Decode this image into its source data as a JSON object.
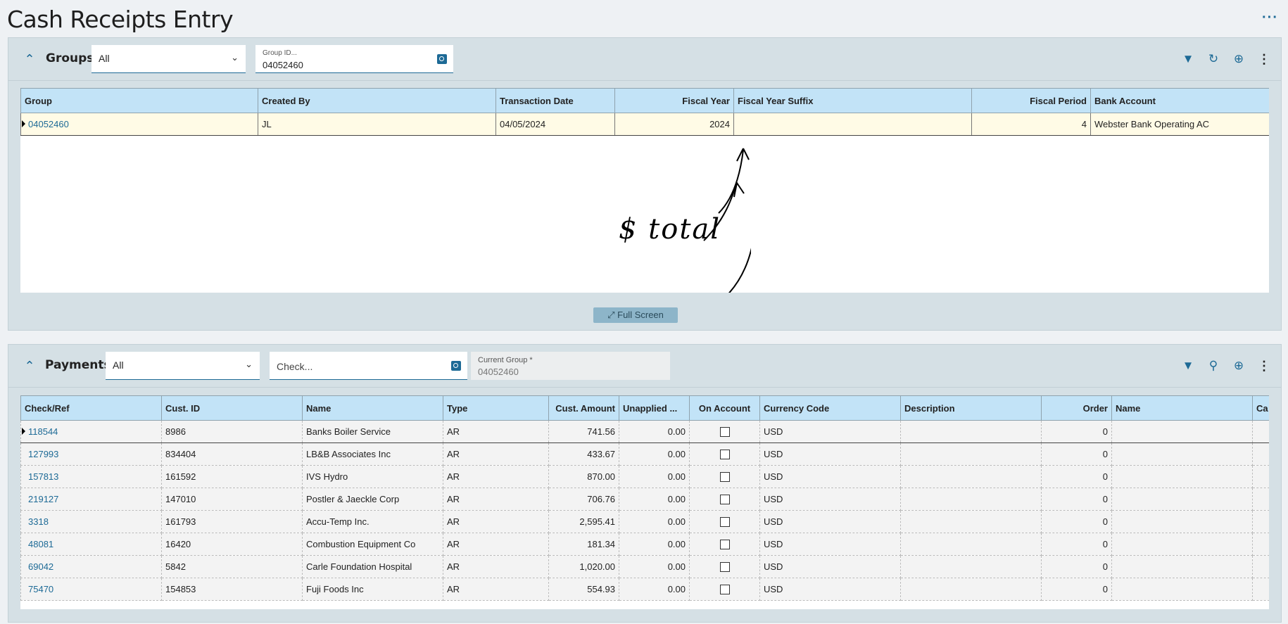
{
  "page": {
    "title": "Cash Receipts Entry",
    "more_label": "···"
  },
  "groups": {
    "title": "Groups",
    "filter_value": "All",
    "search": {
      "label": "Group ID...",
      "value": "04052460"
    },
    "columns": [
      "Group",
      "Created By",
      "Transaction Date",
      "Fiscal Year",
      "Fiscal Year Suffix",
      "Fiscal Period",
      "Bank Account"
    ],
    "rows": [
      {
        "group": "04052460",
        "created_by": "JL",
        "date": "04/05/2024",
        "year": "2024",
        "suffix": "",
        "period": "4",
        "bank": "Webster Bank Operating AC"
      }
    ],
    "full_screen_label": "Full Screen",
    "annotation_text": "$ total"
  },
  "payments": {
    "title": "Payments",
    "filter_value": "All",
    "search_placeholder": "Check...",
    "current_group": {
      "label": "Current Group *",
      "value": "04052460"
    },
    "columns": [
      "Check/Ref",
      "Cust. ID",
      "Name",
      "Type",
      "Cust. Amount",
      "Unapplied ...",
      "On Account",
      "Currency Code",
      "Description",
      "Order",
      "Name",
      "Ca"
    ],
    "rows": [
      {
        "ref": "118544",
        "cust": "8986",
        "name": "Banks Boiler Service",
        "type": "AR",
        "amount": "741.56",
        "unapplied": "0.00",
        "currency": "USD",
        "desc": "",
        "order": "0",
        "name2": ""
      },
      {
        "ref": "127993",
        "cust": "834404",
        "name": "LB&B Associates Inc",
        "type": "AR",
        "amount": "433.67",
        "unapplied": "0.00",
        "currency": "USD",
        "desc": "",
        "order": "0",
        "name2": ""
      },
      {
        "ref": "157813",
        "cust": "161592",
        "name": "IVS Hydro",
        "type": "AR",
        "amount": "870.00",
        "unapplied": "0.00",
        "currency": "USD",
        "desc": "",
        "order": "0",
        "name2": ""
      },
      {
        "ref": "219127",
        "cust": "147010",
        "name": "Postler & Jaeckle Corp",
        "type": "AR",
        "amount": "706.76",
        "unapplied": "0.00",
        "currency": "USD",
        "desc": "",
        "order": "0",
        "name2": ""
      },
      {
        "ref": "3318",
        "cust": "161793",
        "name": "Accu-Temp Inc.",
        "type": "AR",
        "amount": "2,595.41",
        "unapplied": "0.00",
        "currency": "USD",
        "desc": "",
        "order": "0",
        "name2": ""
      },
      {
        "ref": "48081",
        "cust": "16420",
        "name": "Combustion Equipment Co",
        "type": "AR",
        "amount": "181.34",
        "unapplied": "0.00",
        "currency": "USD",
        "desc": "",
        "order": "0",
        "name2": ""
      },
      {
        "ref": "69042",
        "cust": "5842",
        "name": "Carle Foundation Hospital",
        "type": "AR",
        "amount": "1,020.00",
        "unapplied": "0.00",
        "currency": "USD",
        "desc": "",
        "order": "0",
        "name2": ""
      },
      {
        "ref": "75470",
        "cust": "154853",
        "name": "Fuji Foods Inc",
        "type": "AR",
        "amount": "554.93",
        "unapplied": "0.00",
        "currency": "USD",
        "desc": "",
        "order": "0",
        "name2": ""
      }
    ]
  },
  "icons": {
    "collapse": "chevron-up-icon",
    "filter": "filter-icon",
    "refresh": "refresh-icon",
    "add": "plus-circle-icon",
    "more": "more-vertical-icon",
    "search": "search-icon",
    "lookup": "lookup-icon"
  },
  "colors": {
    "accent": "#1d6a96",
    "header_bg": "#c2e3f7",
    "panel_bg": "#d5e0e5",
    "selected_row": "#fffbe6"
  }
}
